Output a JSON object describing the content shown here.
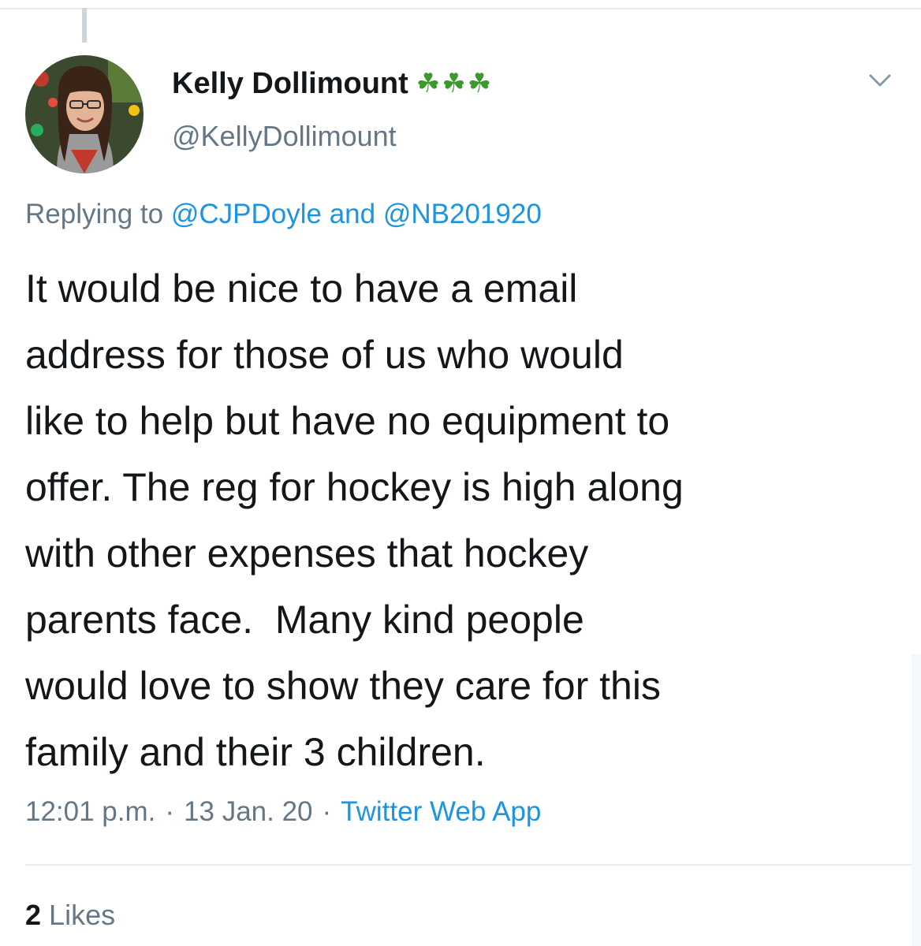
{
  "author": {
    "display_name": "Kelly Dollimount",
    "emoji": "☘☘☘",
    "handle": "@KellyDollimount"
  },
  "reply": {
    "prefix": "Replying to",
    "mention_1": "@CJPDoyle",
    "joiner": "and",
    "mention_2": "@NB201920"
  },
  "tweet": {
    "text": "It would be nice to have a email\naddress for those of us who would\nlike to help but have no equipment to\noffer. The reg for hockey is high along\nwith other expenses that hockey\nparents face.  Many kind people\nwould love to show they care for this\nfamily and their 3 children."
  },
  "meta": {
    "time": "12:01 p.m.",
    "separator": "·",
    "date": "13 Jan. 20",
    "source": "Twitter Web App"
  },
  "engagement": {
    "likes_count": "2",
    "likes_label": "Likes"
  },
  "icons": {
    "menu_caret": "chevron-down-icon",
    "avatar": "avatar"
  },
  "colors": {
    "link": "#1b95e0",
    "secondary_text": "#657786",
    "primary_text": "#14171a",
    "shamrock": "#3a9a2c"
  }
}
